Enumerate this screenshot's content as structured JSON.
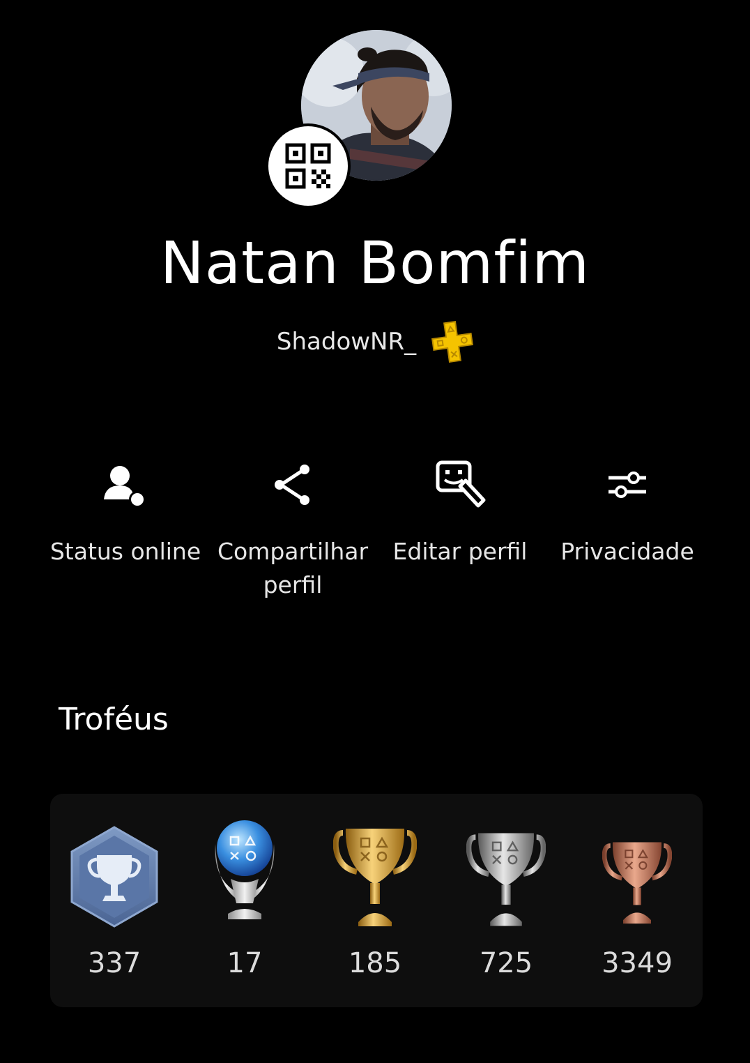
{
  "profile": {
    "name": "Natan Bomfim",
    "handle": "ShadowNR_",
    "membership_icon": "ps-plus-icon",
    "membership_color": "#f5c300"
  },
  "actions": [
    {
      "label": "Status online",
      "icon": "online-status-icon"
    },
    {
      "label": "Compartilhar perfil",
      "icon": "share-icon"
    },
    {
      "label": "Editar perfil",
      "icon": "edit-profile-icon"
    },
    {
      "label": "Privacidade",
      "icon": "privacy-sliders-icon"
    }
  ],
  "trophies": {
    "title": "Troféus",
    "items": [
      {
        "type": "level",
        "icon": "trophy-level-icon",
        "count": "337"
      },
      {
        "type": "platinum",
        "icon": "platinum-trophy-icon",
        "count": "17"
      },
      {
        "type": "gold",
        "icon": "gold-trophy-icon",
        "count": "185"
      },
      {
        "type": "silver",
        "icon": "silver-trophy-icon",
        "count": "725"
      },
      {
        "type": "bronze",
        "icon": "bronze-trophy-icon",
        "count": "3349"
      }
    ]
  }
}
